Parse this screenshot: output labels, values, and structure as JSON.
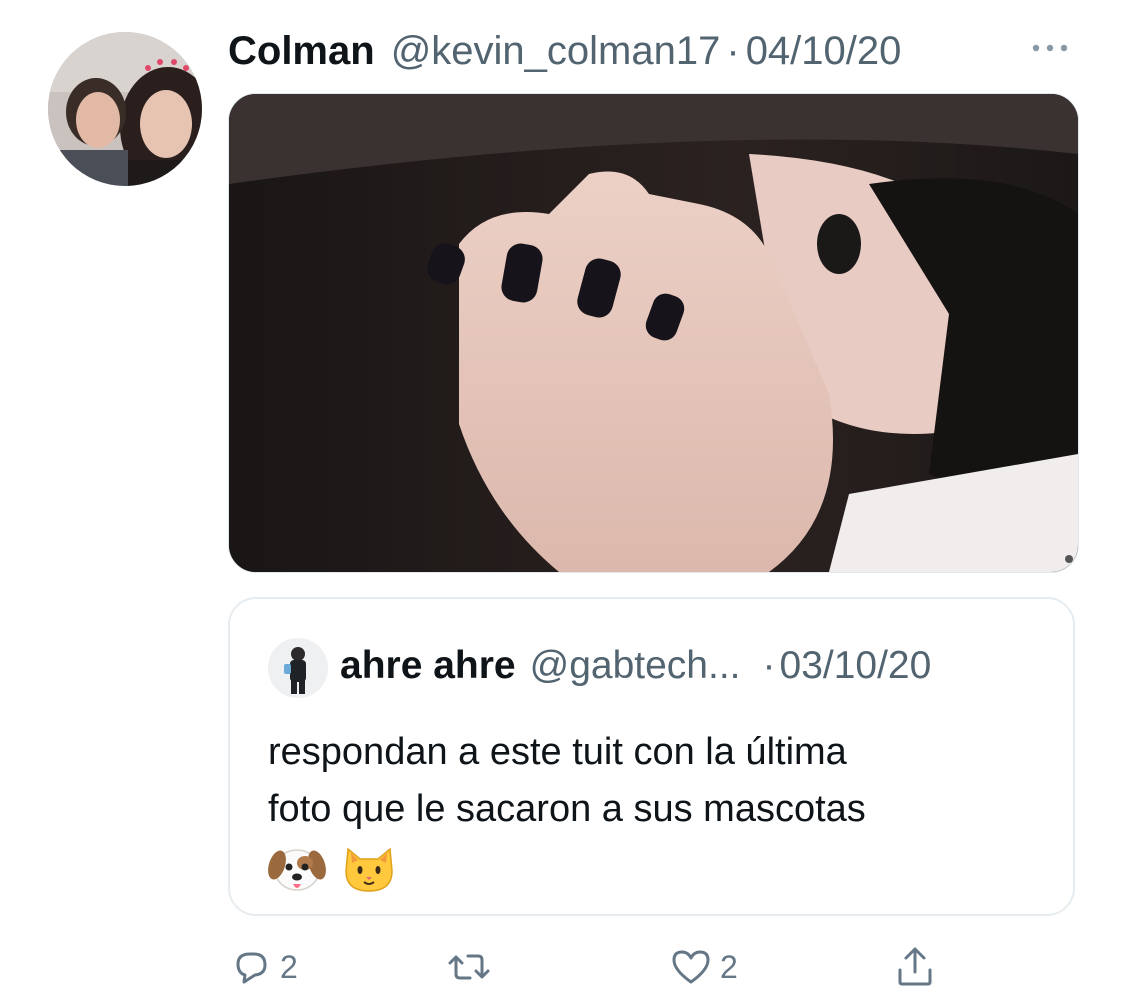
{
  "tweet": {
    "author_name": "Colman",
    "author_handle": "@kevin_colman17",
    "separator": "·",
    "date": "04/10/20",
    "more_icon": "more-horizontal-icon"
  },
  "quoted_tweet": {
    "author_name": "ahre ahre",
    "author_handle": "@gabtech...",
    "separator": "·",
    "date": "03/10/20",
    "text": "respondan a este tuit con la última\nfoto que le sacaron a sus mascotas",
    "emojis": [
      "dog-face-emoji",
      "cat-face-emoji"
    ]
  },
  "actions": {
    "reply": {
      "icon": "reply-icon",
      "count": "2"
    },
    "retweet": {
      "icon": "retweet-icon",
      "count": ""
    },
    "like": {
      "icon": "heart-icon",
      "count": "2"
    },
    "share": {
      "icon": "share-icon"
    }
  },
  "colors": {
    "primary_text": "#0f1419",
    "secondary_text": "#536471",
    "icon_gray": "#657786",
    "border": "#e6ecf0"
  }
}
